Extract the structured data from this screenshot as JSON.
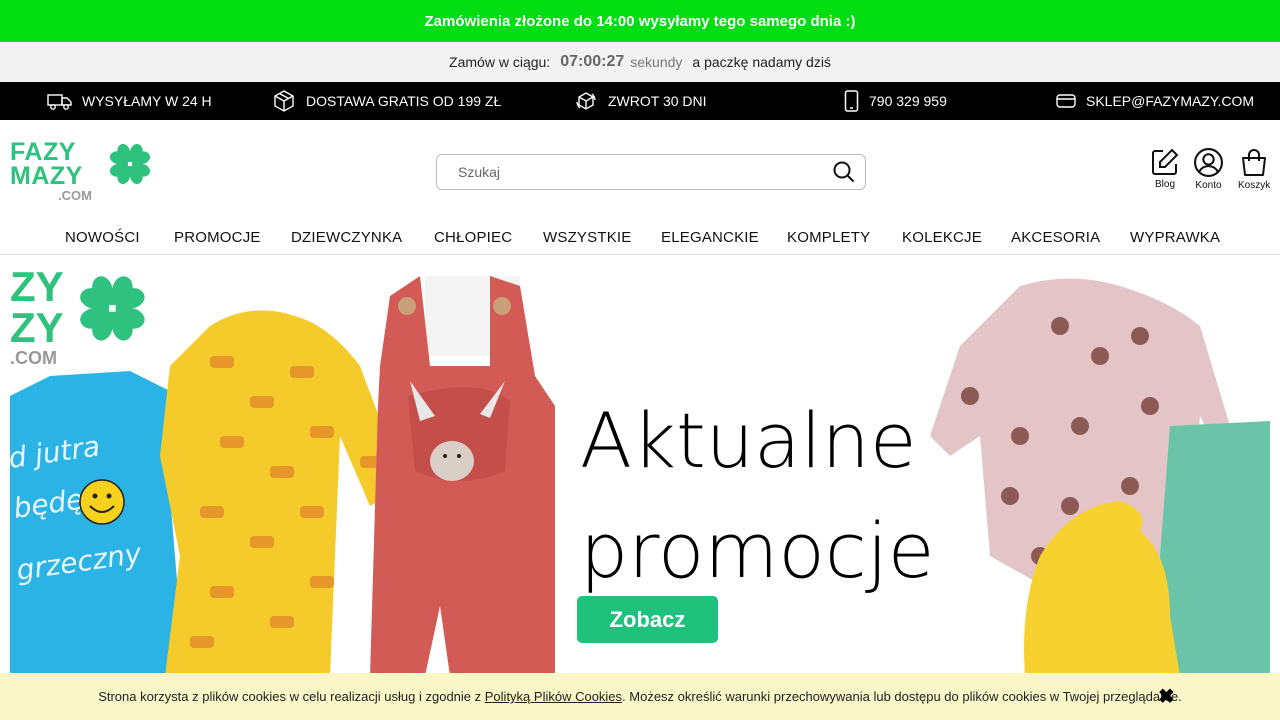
{
  "topbar": {
    "message": "Zamówienia złożone do 14:00 wysyłamy tego samego dnia :)"
  },
  "countdown": {
    "prefix": "Zamów w ciągu:",
    "time": "07:00:27",
    "unit": "sekundy",
    "suffix": "a paczkę nadamy dziś"
  },
  "infobar": {
    "items": [
      {
        "icon": "truck-icon",
        "label": "WYSYŁAMY W 24 H"
      },
      {
        "icon": "box-icon",
        "label": "DOSTAWA GRATIS OD 199 ZŁ"
      },
      {
        "icon": "return-icon",
        "label": "ZWROT 30 DNI"
      },
      {
        "icon": "phone-icon",
        "label": "790 329 959"
      },
      {
        "icon": "mail-icon",
        "label": "SKLEP@FAZYMAZY.COM"
      }
    ]
  },
  "logo": {
    "line1": "FAZY",
    "line2": "MAZY",
    "tld": ".COM"
  },
  "search": {
    "placeholder": "Szukaj",
    "value": ""
  },
  "header_icons": [
    {
      "icon": "blog-icon",
      "label": "Blog"
    },
    {
      "icon": "account-icon",
      "label": "Konto"
    },
    {
      "icon": "cart-icon",
      "label": "Koszyk"
    }
  ],
  "nav": {
    "items": [
      "NOWOŚCI",
      "PROMOCJE",
      "DZIEWCZYNKA",
      "CHŁOPIEC",
      "WSZYSTKIE",
      "ELEGANCKIE",
      "KOMPLETY",
      "KOLEKCJE",
      "AKCESORIA",
      "WYPRAWKA"
    ]
  },
  "hero": {
    "logo_partial": {
      "line1": "ZY",
      "line2": "ZY",
      "tld": ".COM"
    },
    "shirt_text": [
      "d jutra",
      "będę",
      "grzeczny"
    ],
    "title_line1": "Aktualne",
    "title_line2": "promocje",
    "button_label": "Zobacz"
  },
  "cookie": {
    "text_before": "Strona korzysta z plików cookies w celu realizacji usług i zgodnie z",
    "link": "Polityką Plików Cookies",
    "text_after": ". Możesz określić warunki przechowywania lub dostępu do plików cookies w Twojej przeglądarce."
  },
  "colors": {
    "brand_green": "#2ec27e",
    "topbar_green": "#00dd11",
    "button_green": "#1fc27d",
    "cookie_bg": "#fbf6c8"
  }
}
